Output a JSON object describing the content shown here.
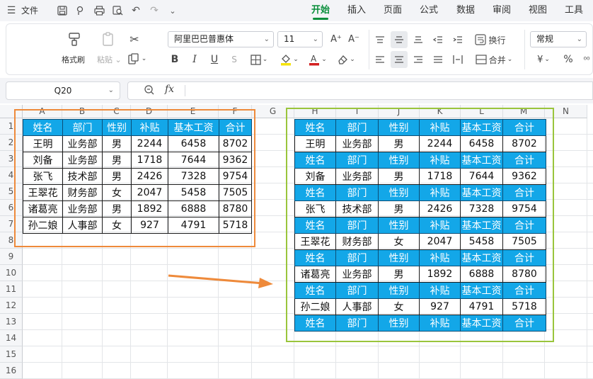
{
  "menu": {
    "file": "文件",
    "tabs": [
      "开始",
      "插入",
      "页面",
      "公式",
      "数据",
      "审阅",
      "视图",
      "工具"
    ],
    "active_tab": "开始"
  },
  "ribbon": {
    "format_painter": "格式刷",
    "paste": "粘贴",
    "font_name": "阿里巴巴普惠体",
    "font_size": "11",
    "wrap": "换行",
    "merge": "合并",
    "number_format": "常规",
    "currency": "¥",
    "percent": "%",
    "bold": "B",
    "italic": "I",
    "underline": "U",
    "font_color_letter": "A",
    "grow_font": "A⁺",
    "shrink_font": "A⁻",
    "colors": {
      "highlight": "#f5e30a",
      "font": "#d32020",
      "accent": "#0a8f3c"
    }
  },
  "formula_bar": {
    "name_box": "Q20",
    "fx": "fx",
    "value": ""
  },
  "sheet": {
    "columns": [
      "A",
      "B",
      "C",
      "D",
      "E",
      "F",
      "G",
      "H",
      "I",
      "J",
      "K",
      "L",
      "M",
      "N"
    ],
    "rows": [
      "1",
      "2",
      "3",
      "4",
      "5",
      "6",
      "7",
      "8",
      "9",
      "10",
      "11",
      "12",
      "13",
      "14",
      "15",
      "16"
    ],
    "source_table": {
      "header": [
        "姓名",
        "部门",
        "性别",
        "补贴",
        "基本工资",
        "合计"
      ],
      "rows": [
        [
          "王明",
          "业务部",
          "男",
          "2244",
          "6458",
          "8702"
        ],
        [
          "刘备",
          "业务部",
          "男",
          "1718",
          "7644",
          "9362"
        ],
        [
          "张飞",
          "技术部",
          "男",
          "2426",
          "7328",
          "9754"
        ],
        [
          "王翠花",
          "财务部",
          "女",
          "2047",
          "5458",
          "7505"
        ],
        [
          "诸葛亮",
          "业务部",
          "男",
          "1892",
          "6888",
          "8780"
        ],
        [
          "孙二娘",
          "人事部",
          "女",
          "927",
          "4791",
          "5718"
        ]
      ]
    },
    "result_table": {
      "header": [
        "姓名",
        "部门",
        "性别",
        "补贴",
        "基本工资",
        "合计"
      ],
      "rows": [
        [
          "王明",
          "业务部",
          "男",
          "2244",
          "6458",
          "8702"
        ],
        [
          "刘备",
          "业务部",
          "男",
          "1718",
          "7644",
          "9362"
        ],
        [
          "张飞",
          "技术部",
          "男",
          "2426",
          "7328",
          "9754"
        ],
        [
          "王翠花",
          "财务部",
          "女",
          "2047",
          "5458",
          "7505"
        ],
        [
          "诸葛亮",
          "业务部",
          "男",
          "1892",
          "6888",
          "8780"
        ],
        [
          "孙二娘",
          "人事部",
          "女",
          "927",
          "4791",
          "5718"
        ]
      ]
    },
    "colors": {
      "header_fill": "#13a7e8",
      "source_frame": "#ee8a3b",
      "result_frame": "#9ac53c",
      "arrow": "#ee8a3b"
    }
  }
}
